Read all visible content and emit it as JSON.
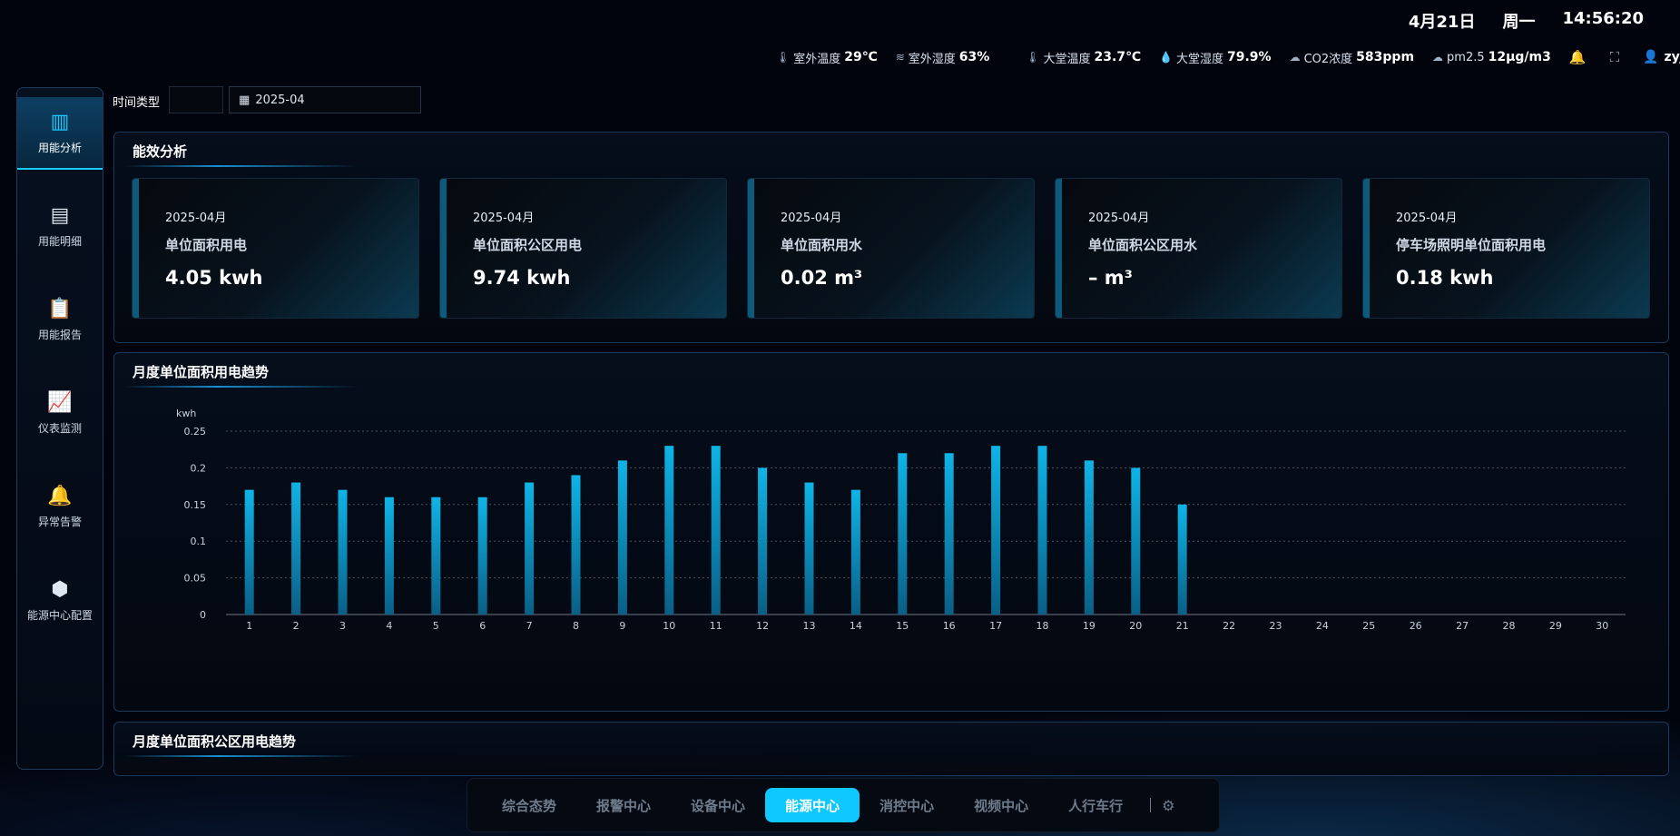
{
  "header": {
    "date": "4月21日",
    "weekday": "周一",
    "time": "14:56:20",
    "env": [
      {
        "icon": "thermometer-icon",
        "label": "室外温度",
        "value": "29℃"
      },
      {
        "icon": "humidity-icon",
        "label": "室外湿度",
        "value": "63%"
      },
      {
        "icon": "thermometer-icon",
        "label": "大堂温度",
        "value": "23.7℃"
      },
      {
        "icon": "droplet-icon",
        "label": "大堂湿度",
        "value": "79.9%"
      },
      {
        "icon": "cloud-icon",
        "label": "CO2浓度",
        "value": "583ppm"
      },
      {
        "icon": "cloud-icon",
        "label": "pm2.5",
        "value": "12μg/m3"
      }
    ],
    "user": "zyjt"
  },
  "sidebar": {
    "items": [
      {
        "label": "用能分析",
        "icon": "bar-chart-icon",
        "active": true
      },
      {
        "label": "用能明细",
        "icon": "detail-list-icon",
        "active": false
      },
      {
        "label": "用能报告",
        "icon": "clipboard-icon",
        "active": false
      },
      {
        "label": "仪表监测",
        "icon": "trend-chart-icon",
        "active": false
      },
      {
        "label": "异常告警",
        "icon": "alarm-bell-icon",
        "active": false
      },
      {
        "label": "能源中心配置",
        "icon": "cube-icon",
        "active": false
      }
    ]
  },
  "filter": {
    "label": "时间类型",
    "date": "2025-04"
  },
  "efficiency": {
    "title": "能效分析",
    "cards": [
      {
        "period": "2025-04月",
        "label": "单位面积用电",
        "value": "4.05 kwh"
      },
      {
        "period": "2025-04月",
        "label": "单位面积公区用电",
        "value": "9.74 kwh"
      },
      {
        "period": "2025-04月",
        "label": "单位面积用水",
        "value": "0.02 m³"
      },
      {
        "period": "2025-04月",
        "label": "单位面积公区用水",
        "value": "– m³"
      },
      {
        "period": "2025-04月",
        "label": "停车场照明单位面积用电",
        "value": "0.18 kwh"
      }
    ]
  },
  "trend": {
    "title": "月度单位面积用电趋势"
  },
  "trend2": {
    "title": "月度单位面积公区用电趋势"
  },
  "chart_data": {
    "type": "bar",
    "title": "月度单位面积用电趋势",
    "ylabel": "kwh",
    "xlabel": "",
    "ylim": [
      0,
      0.25
    ],
    "yticks": [
      "0",
      "0.05",
      "0.1",
      "0.15",
      "0.2",
      "0.25"
    ],
    "grid": true,
    "bar_color": "#0fb4e6",
    "categories": [
      "1",
      "2",
      "3",
      "4",
      "5",
      "6",
      "7",
      "8",
      "9",
      "10",
      "11",
      "12",
      "13",
      "14",
      "15",
      "16",
      "17",
      "18",
      "19",
      "20",
      "21",
      "22",
      "23",
      "24",
      "25",
      "26",
      "27",
      "28",
      "29",
      "30"
    ],
    "values": [
      0.17,
      0.18,
      0.17,
      0.16,
      0.16,
      0.16,
      0.18,
      0.19,
      0.21,
      0.23,
      0.23,
      0.2,
      0.18,
      0.17,
      0.22,
      0.22,
      0.23,
      0.23,
      0.21,
      0.2,
      0.15,
      null,
      null,
      null,
      null,
      null,
      null,
      null,
      null,
      null
    ]
  },
  "bottom_nav": {
    "items": [
      {
        "label": "综合态势",
        "active": false
      },
      {
        "label": "报警中心",
        "active": false
      },
      {
        "label": "设备中心",
        "active": false
      },
      {
        "label": "能源中心",
        "active": true
      },
      {
        "label": "消控中心",
        "active": false
      },
      {
        "label": "视频中心",
        "active": false
      },
      {
        "label": "人行车行",
        "active": false
      }
    ]
  },
  "colors": {
    "accent": "#0fc8ff",
    "bar": "#0fb4e6",
    "panel_border": "#183a5e",
    "background": "#02040d"
  }
}
